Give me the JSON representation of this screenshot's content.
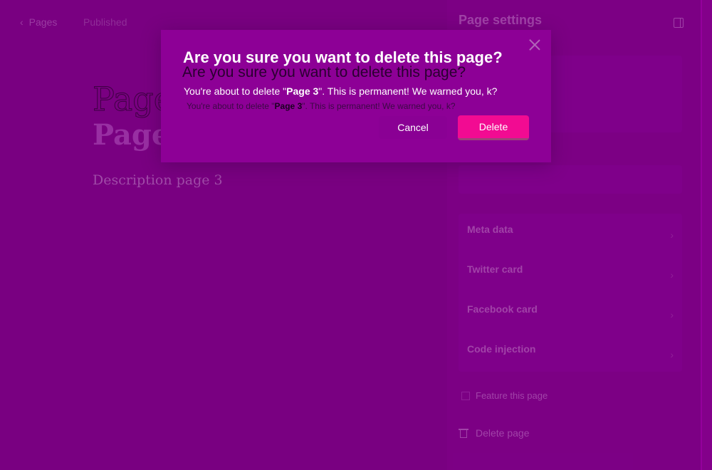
{
  "topbar": {
    "back_label": "Pages",
    "status": "Published"
  },
  "editor": {
    "title": "Page 3",
    "description": "Description page 3"
  },
  "panel": {
    "title": "Page settings",
    "settings": [
      {
        "title": "Meta data"
      },
      {
        "title": "Twitter card"
      },
      {
        "title": "Facebook card"
      },
      {
        "title": "Code injection"
      }
    ],
    "feature_label": "Feature this page",
    "delete_label": "Delete page"
  },
  "modal": {
    "title": "Are you sure you want to delete this page?",
    "body_prefix": "You're about to delete \"",
    "body_bold": "Page 3",
    "body_suffix": "\". This is permanent! We warned you, k?",
    "cancel_label": "Cancel",
    "delete_label": "Delete"
  },
  "colors": {
    "overlay": "#7f0086",
    "delete_button": "#f20b92",
    "modal_background": "#8d0096"
  }
}
